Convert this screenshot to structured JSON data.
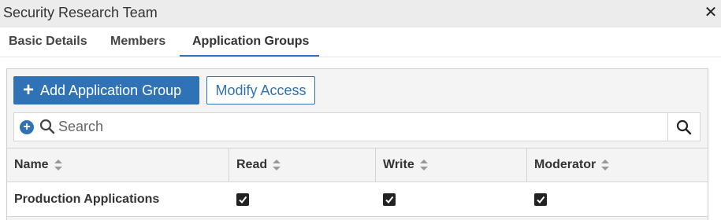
{
  "window": {
    "title": "Security Research Team",
    "close_glyph": "✕"
  },
  "tabs": [
    {
      "label": "Basic Details",
      "active": false
    },
    {
      "label": "Members",
      "active": false
    },
    {
      "label": "Application Groups",
      "active": true
    }
  ],
  "toolbar": {
    "add_label": "Add Application Group",
    "add_icon": "plus-icon",
    "modify_label": "Modify Access"
  },
  "search": {
    "placeholder": "Search",
    "value": ""
  },
  "table": {
    "columns": [
      "Name",
      "Read",
      "Write",
      "Moderator"
    ],
    "rows": [
      {
        "name": "Production Applications",
        "read": true,
        "write": true,
        "moderator": true
      }
    ]
  },
  "colors": {
    "accent": "#2f73b6",
    "title_bar": "#ececec",
    "panel": "#f4f4f4"
  }
}
